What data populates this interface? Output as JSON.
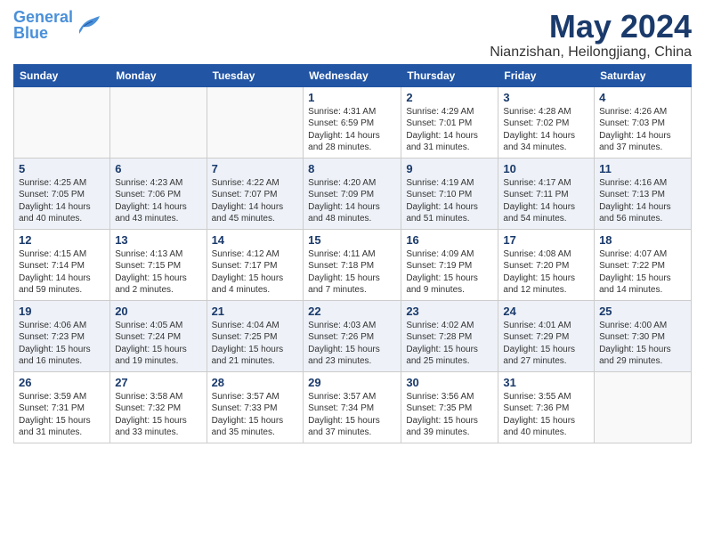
{
  "header": {
    "logo_general": "General",
    "logo_blue": "Blue",
    "month_title": "May 2024",
    "location": "Nianzishan, Heilongjiang, China"
  },
  "weekdays": [
    "Sunday",
    "Monday",
    "Tuesday",
    "Wednesday",
    "Thursday",
    "Friday",
    "Saturday"
  ],
  "weeks": [
    [
      {
        "day": "",
        "info": ""
      },
      {
        "day": "",
        "info": ""
      },
      {
        "day": "",
        "info": ""
      },
      {
        "day": "1",
        "info": "Sunrise: 4:31 AM\nSunset: 6:59 PM\nDaylight: 14 hours\nand 28 minutes."
      },
      {
        "day": "2",
        "info": "Sunrise: 4:29 AM\nSunset: 7:01 PM\nDaylight: 14 hours\nand 31 minutes."
      },
      {
        "day": "3",
        "info": "Sunrise: 4:28 AM\nSunset: 7:02 PM\nDaylight: 14 hours\nand 34 minutes."
      },
      {
        "day": "4",
        "info": "Sunrise: 4:26 AM\nSunset: 7:03 PM\nDaylight: 14 hours\nand 37 minutes."
      }
    ],
    [
      {
        "day": "5",
        "info": "Sunrise: 4:25 AM\nSunset: 7:05 PM\nDaylight: 14 hours\nand 40 minutes."
      },
      {
        "day": "6",
        "info": "Sunrise: 4:23 AM\nSunset: 7:06 PM\nDaylight: 14 hours\nand 43 minutes."
      },
      {
        "day": "7",
        "info": "Sunrise: 4:22 AM\nSunset: 7:07 PM\nDaylight: 14 hours\nand 45 minutes."
      },
      {
        "day": "8",
        "info": "Sunrise: 4:20 AM\nSunset: 7:09 PM\nDaylight: 14 hours\nand 48 minutes."
      },
      {
        "day": "9",
        "info": "Sunrise: 4:19 AM\nSunset: 7:10 PM\nDaylight: 14 hours\nand 51 minutes."
      },
      {
        "day": "10",
        "info": "Sunrise: 4:17 AM\nSunset: 7:11 PM\nDaylight: 14 hours\nand 54 minutes."
      },
      {
        "day": "11",
        "info": "Sunrise: 4:16 AM\nSunset: 7:13 PM\nDaylight: 14 hours\nand 56 minutes."
      }
    ],
    [
      {
        "day": "12",
        "info": "Sunrise: 4:15 AM\nSunset: 7:14 PM\nDaylight: 14 hours\nand 59 minutes."
      },
      {
        "day": "13",
        "info": "Sunrise: 4:13 AM\nSunset: 7:15 PM\nDaylight: 15 hours\nand 2 minutes."
      },
      {
        "day": "14",
        "info": "Sunrise: 4:12 AM\nSunset: 7:17 PM\nDaylight: 15 hours\nand 4 minutes."
      },
      {
        "day": "15",
        "info": "Sunrise: 4:11 AM\nSunset: 7:18 PM\nDaylight: 15 hours\nand 7 minutes."
      },
      {
        "day": "16",
        "info": "Sunrise: 4:09 AM\nSunset: 7:19 PM\nDaylight: 15 hours\nand 9 minutes."
      },
      {
        "day": "17",
        "info": "Sunrise: 4:08 AM\nSunset: 7:20 PM\nDaylight: 15 hours\nand 12 minutes."
      },
      {
        "day": "18",
        "info": "Sunrise: 4:07 AM\nSunset: 7:22 PM\nDaylight: 15 hours\nand 14 minutes."
      }
    ],
    [
      {
        "day": "19",
        "info": "Sunrise: 4:06 AM\nSunset: 7:23 PM\nDaylight: 15 hours\nand 16 minutes."
      },
      {
        "day": "20",
        "info": "Sunrise: 4:05 AM\nSunset: 7:24 PM\nDaylight: 15 hours\nand 19 minutes."
      },
      {
        "day": "21",
        "info": "Sunrise: 4:04 AM\nSunset: 7:25 PM\nDaylight: 15 hours\nand 21 minutes."
      },
      {
        "day": "22",
        "info": "Sunrise: 4:03 AM\nSunset: 7:26 PM\nDaylight: 15 hours\nand 23 minutes."
      },
      {
        "day": "23",
        "info": "Sunrise: 4:02 AM\nSunset: 7:28 PM\nDaylight: 15 hours\nand 25 minutes."
      },
      {
        "day": "24",
        "info": "Sunrise: 4:01 AM\nSunset: 7:29 PM\nDaylight: 15 hours\nand 27 minutes."
      },
      {
        "day": "25",
        "info": "Sunrise: 4:00 AM\nSunset: 7:30 PM\nDaylight: 15 hours\nand 29 minutes."
      }
    ],
    [
      {
        "day": "26",
        "info": "Sunrise: 3:59 AM\nSunset: 7:31 PM\nDaylight: 15 hours\nand 31 minutes."
      },
      {
        "day": "27",
        "info": "Sunrise: 3:58 AM\nSunset: 7:32 PM\nDaylight: 15 hours\nand 33 minutes."
      },
      {
        "day": "28",
        "info": "Sunrise: 3:57 AM\nSunset: 7:33 PM\nDaylight: 15 hours\nand 35 minutes."
      },
      {
        "day": "29",
        "info": "Sunrise: 3:57 AM\nSunset: 7:34 PM\nDaylight: 15 hours\nand 37 minutes."
      },
      {
        "day": "30",
        "info": "Sunrise: 3:56 AM\nSunset: 7:35 PM\nDaylight: 15 hours\nand 39 minutes."
      },
      {
        "day": "31",
        "info": "Sunrise: 3:55 AM\nSunset: 7:36 PM\nDaylight: 15 hours\nand 40 minutes."
      },
      {
        "day": "",
        "info": ""
      }
    ]
  ]
}
